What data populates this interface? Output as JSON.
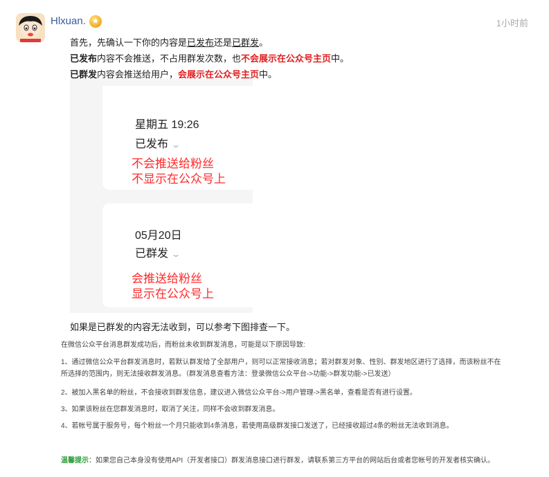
{
  "header": {
    "username": "Hlxuan.",
    "badge_icon": "star-medal-icon",
    "time": "1小时前"
  },
  "answer": {
    "line1": {
      "p1": "首先，先确认一下你的内容是",
      "u1": "已发布",
      "p2": "还是",
      "u2": "已群发",
      "p3": "。"
    },
    "line2": {
      "b1": "已发布",
      "p1": "内容不会推送，不占用群发次数，也",
      "r1": "不会展示在公众号主页",
      "p2": "中。"
    },
    "line3": {
      "b1": "已群发",
      "p1": "内容会推送给用户，",
      "r1": "会展示在公众号主页",
      "p2": "中。"
    },
    "screenshot": {
      "card1": {
        "date": "星期五 19:26",
        "status": "已发布",
        "note_line1": "不会推送给粉丝",
        "note_line2": "不显示在公众号上"
      },
      "card2": {
        "date": "05月20日",
        "status": "已群发",
        "note_line1": "会推送给粉丝",
        "note_line2": "显示在公众号上"
      },
      "chevron_icon": "chevron-down-icon"
    },
    "follow_up": "如果是已群发的内容无法收到，可以参考下图排查一下。"
  },
  "reference": {
    "intro": "在微信公众平台消息群发成功后，而粉丝未收到群发消息，可能是以下原因导致:",
    "item1_line1": "1、通过微信公众平台群发消息时，若默认群发给了全部用户，则可以正常接收消息；若对群发对象、性别、群发地区进行了选择，而该粉丝不在",
    "item1_line2": "所选择的范围内，则无法接收群发消息。（群发消息查看方法：登录微信公众平台->功能->群发功能->已发送）",
    "item2": "2、被加入黑名单的粉丝，不会接收到群发信息，建议进入微信公众平台->用户管理->黑名单，查看是否有进行设置。",
    "item3": "3、如果该粉丝在您群发消息时，取消了关注，同样不会收到群发消息。",
    "item4": "4、若帐号属于服务号，每个粉丝一个月只能收到4条消息，若使用高级群发接口发送了，已经接收超过4条的粉丝无法收到消息。",
    "tip_label": "温馨提示",
    "tip_text": "：如果您自己本身没有使用API（开发者接口）群发消息接口进行群发，请联系第三方平台的网站后台或者您帐号的开发者核实确认。"
  }
}
